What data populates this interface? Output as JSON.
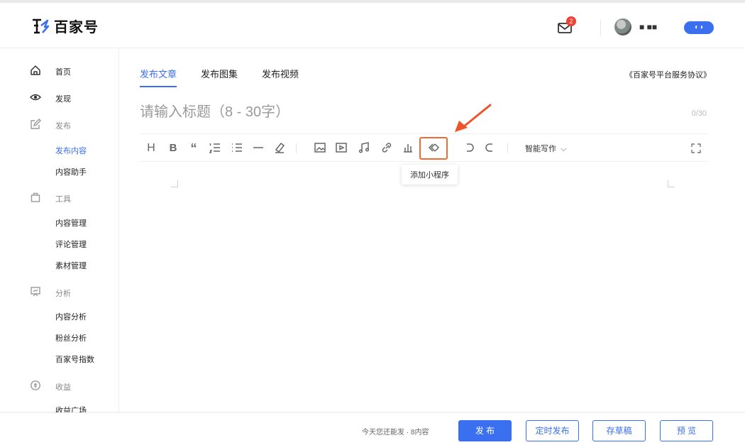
{
  "header": {
    "logo_text": "百家号",
    "mail_badge": "2",
    "username": "■ ■■",
    "toggle_label": "◐◑"
  },
  "sidebar": {
    "home": "首页",
    "discover": "发现",
    "publish_group": "发布",
    "publish_sub": [
      "发布内容",
      "内容助手"
    ],
    "tools_group": "工具",
    "tools_sub": [
      "内容管理",
      "评论管理",
      "素材管理"
    ],
    "analysis_group": "分析",
    "analysis_sub": [
      "内容分析",
      "粉丝分析",
      "百家号指数"
    ],
    "income_group": "收益",
    "income_sub": [
      "收益广场"
    ]
  },
  "main": {
    "tabs": [
      "发布文章",
      "发布图集",
      "发布视频"
    ],
    "agreement": "《百家号平台服务协议》",
    "title_placeholder": "请输入标题（8 - 30字）",
    "title_counter": "0/30"
  },
  "toolbar": {
    "smart_write": "智能写作",
    "tooltip": "添加小程序"
  },
  "footer": {
    "quota": "今天您还能发 · 8内容",
    "publish": "发 布",
    "schedule": "定时发布",
    "draft": "存草稿",
    "preview": "预 览"
  },
  "colors": {
    "accent": "#3a6ff0",
    "highlight": "#f06a35",
    "badge": "#f04134"
  }
}
